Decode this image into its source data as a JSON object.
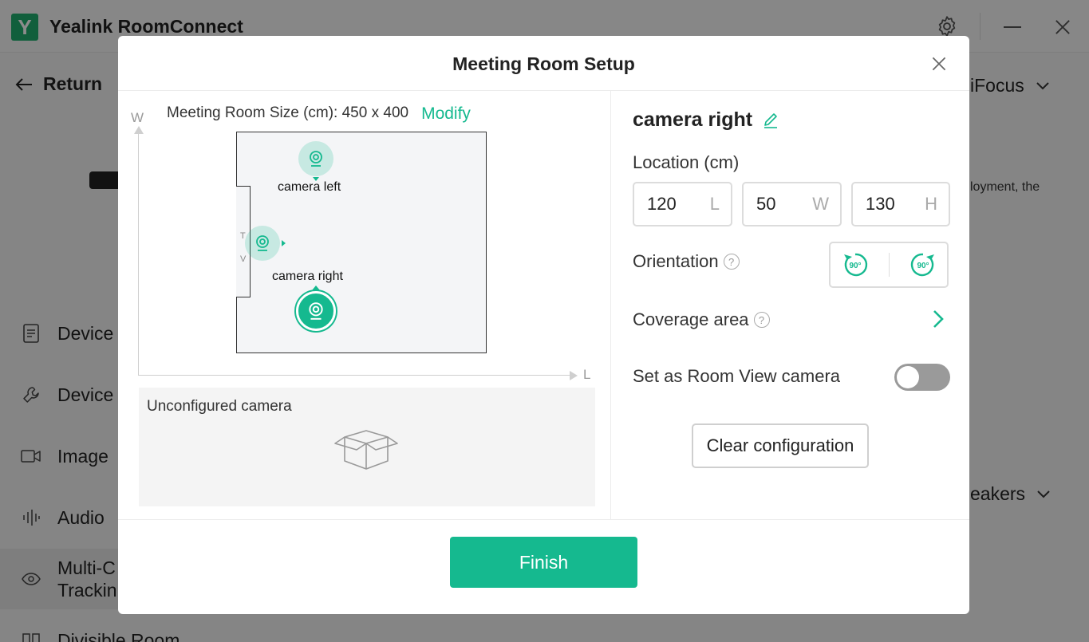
{
  "app": {
    "title": "Yealink RoomConnect",
    "logo_letter": "Y"
  },
  "nav": {
    "return_label": "Return"
  },
  "sidebar": {
    "items": [
      {
        "label": "Device"
      },
      {
        "label": "Device"
      },
      {
        "label": "Image"
      },
      {
        "label": "Audio"
      },
      {
        "label_line1": "Multi-C",
        "label_line2": "Trackin"
      },
      {
        "label": "Divisible Room"
      }
    ]
  },
  "background_right": {
    "focus_label": "iFocus",
    "deployment_text": "loyment, the",
    "speakers_label": "eakers"
  },
  "modal": {
    "title": "Meeting Room Setup",
    "room": {
      "size_text": "Meeting Room Size (cm): 450 x 400",
      "modify_label": "Modify",
      "axis_w": "W",
      "axis_l": "L",
      "tv_letters": [
        "T",
        "V"
      ],
      "cameras": [
        {
          "name": "camera left"
        },
        {
          "name": "camera right"
        }
      ]
    },
    "unconfigured_label": "Unconfigured camera",
    "camera": {
      "name": "camera right",
      "location_label": "Location (cm)",
      "location": [
        {
          "value": "120",
          "unit": "L"
        },
        {
          "value": "50",
          "unit": "W"
        },
        {
          "value": "130",
          "unit": "H"
        }
      ],
      "orientation_label": "Orientation",
      "rotate_left_text": "90°",
      "rotate_right_text": "90°",
      "coverage_label": "Coverage area",
      "room_view_label": "Set as Room View camera",
      "room_view_enabled": false,
      "clear_label": "Clear configuration",
      "help_glyph": "?"
    },
    "finish_label": "Finish"
  },
  "colors": {
    "accent": "#15b98f",
    "logo": "#1fae6e",
    "toggle_off": "#9a9a9a"
  }
}
